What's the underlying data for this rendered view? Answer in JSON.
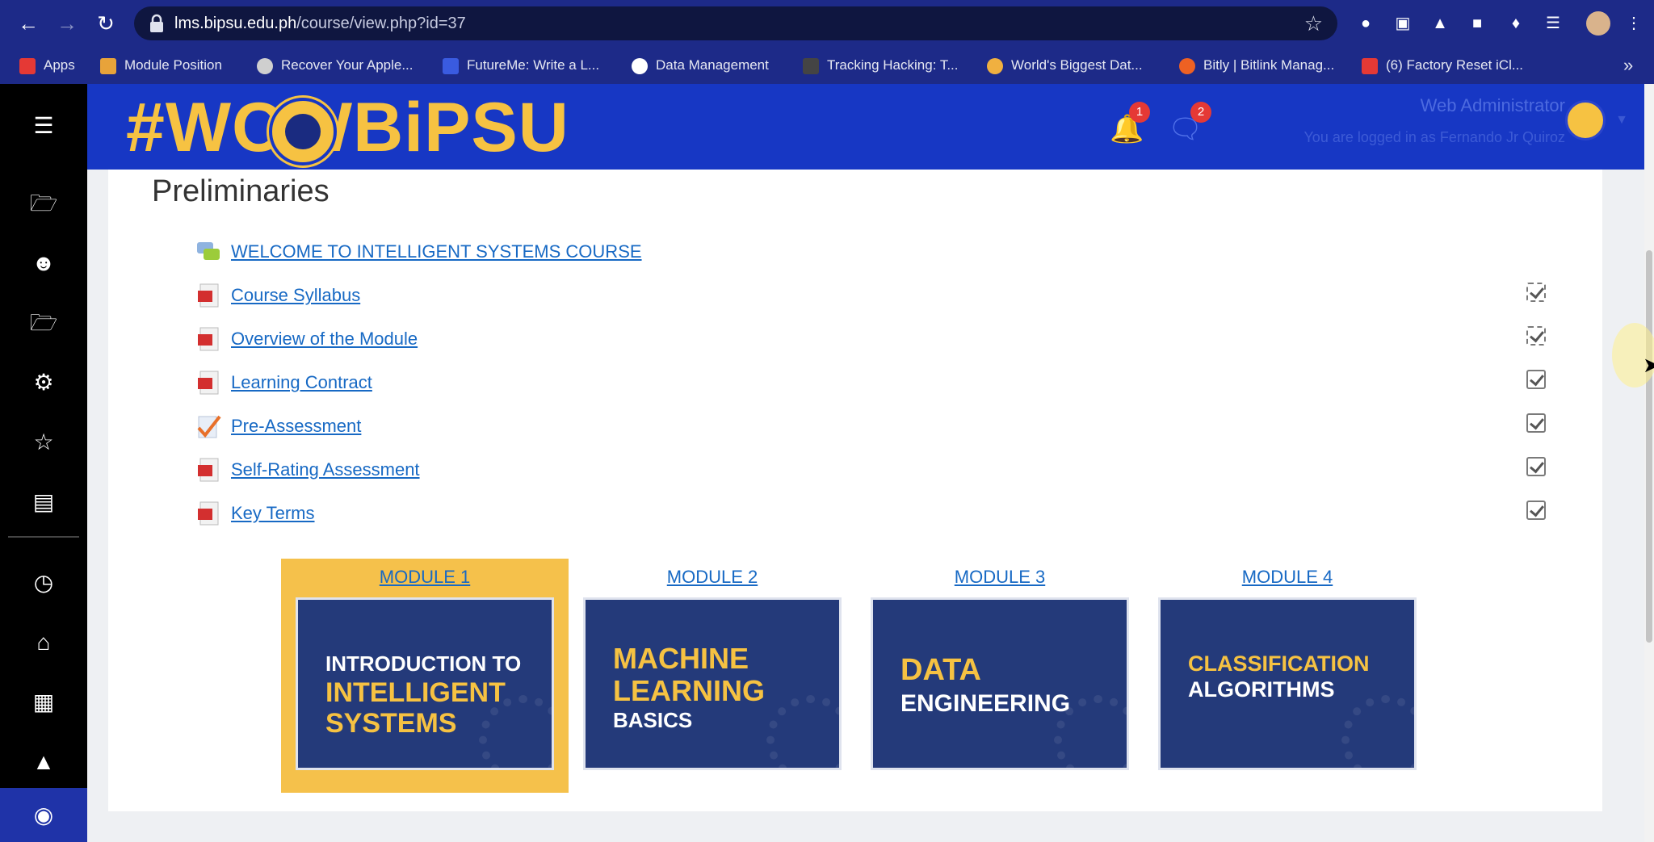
{
  "browser": {
    "url_host": "lms.bipsu.edu.ph",
    "url_path": "/course/view.php?id=37",
    "bookmarks": [
      {
        "label": "Apps",
        "color": "#e53935"
      },
      {
        "label": "Module Position",
        "color": "#e8a33a"
      },
      {
        "label": "Recover Your Apple...",
        "color": "#cfcfcf"
      },
      {
        "label": "FutureMe: Write a L...",
        "color": "#3a5be0"
      },
      {
        "label": "Data Management",
        "color": "#ffffff"
      },
      {
        "label": "Tracking Hacking: T...",
        "color": "#444444"
      },
      {
        "label": "World's Biggest Dat...",
        "color": "#f0b040"
      },
      {
        "label": "Bitly | Bitlink Manag...",
        "color": "#ee6123"
      },
      {
        "label": "(6) Factory Reset iCl...",
        "color": "#e53935"
      }
    ]
  },
  "header": {
    "logo_text": "#WOWBiPSU",
    "notification_count": "1",
    "message_count": "2",
    "user_role": "Web Administrator",
    "logged_in_text": "You are logged in as Fernando Jr Quiroz"
  },
  "section": {
    "title": "Preliminaries",
    "activities": [
      {
        "label": "WELCOME TO INTELLIGENT SYSTEMS COURSE",
        "icon": "forum-icon",
        "checkbox": "none"
      },
      {
        "label": "Course Syllabus",
        "icon": "pdf-icon",
        "checkbox": "dashed"
      },
      {
        "label": "Overview of the Module",
        "icon": "pdf-icon",
        "checkbox": "dashed"
      },
      {
        "label": "Learning Contract",
        "icon": "pdf-icon",
        "checkbox": "solid"
      },
      {
        "label": "Pre-Assessment",
        "icon": "quiz-icon",
        "checkbox": "solid"
      },
      {
        "label": "Self-Rating Assessment",
        "icon": "pdf-icon",
        "checkbox": "solid"
      },
      {
        "label": "Key Terms",
        "icon": "pdf-icon",
        "checkbox": "solid"
      }
    ]
  },
  "modules": [
    {
      "title": "MODULE 1",
      "lines": [
        "INTRODUCTION TO",
        "INTELLIGENT",
        "SYSTEMS"
      ],
      "highlighted": true
    },
    {
      "title": "MODULE 2",
      "lines": [
        "MACHINE",
        "LEARNING",
        "BASICS"
      ],
      "highlighted": false
    },
    {
      "title": "MODULE 3",
      "lines": [
        "DATA",
        "ENGINEERING"
      ],
      "highlighted": false
    },
    {
      "title": "MODULE 4",
      "lines": [
        "CLASSIFICATION",
        "ALGORITHMS"
      ],
      "highlighted": false
    }
  ],
  "colors": {
    "brand_blue": "#1737c4",
    "brand_yellow": "#f6c242",
    "card_navy": "#243a7a",
    "link": "#1769c4"
  }
}
